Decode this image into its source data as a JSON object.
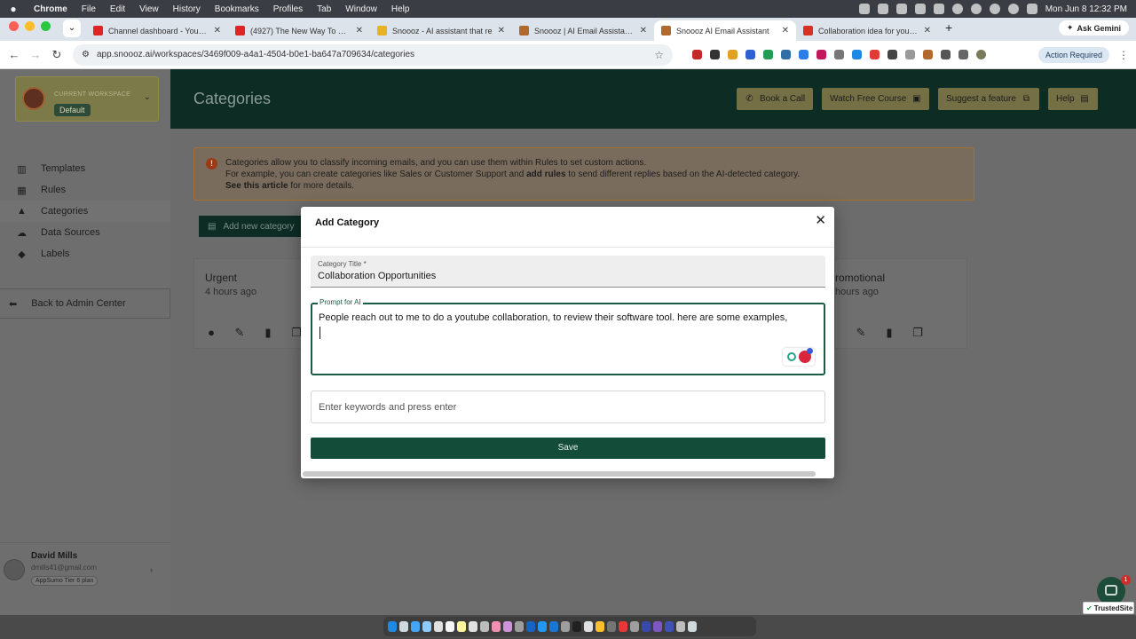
{
  "menubar": {
    "app": "Chrome",
    "items": [
      "File",
      "Edit",
      "View",
      "History",
      "Bookmarks",
      "Profiles",
      "Tab",
      "Window",
      "Help"
    ],
    "clock": "Mon Jun 8  12:32 PM"
  },
  "tabs": [
    {
      "label": "Channel dashboard - YouTube",
      "color": "#e02424"
    },
    {
      "label": "(4927) The New Way To Grow",
      "color": "#e02424"
    },
    {
      "label": "Snoooz - AI assistant that re",
      "color": "#e8b321"
    },
    {
      "label": "Snoooz | AI Email Assistant fo",
      "color": "#b06a2e"
    },
    {
      "label": "Snoooz AI Email Assistant",
      "color": "#b06a2e"
    },
    {
      "label": "Collaboration idea for your Yo",
      "color": "#d93025"
    }
  ],
  "ask_gemini": "Ask Gemini",
  "address": "app.snoooz.ai/workspaces/3469f009-a4a1-4504-b0e1-ba647a709634/categories",
  "action_required": "Action Required",
  "workspace": {
    "label": "CURRENT WORKSPACE",
    "name": "Default"
  },
  "nav": [
    {
      "label": "Templates",
      "icon": "templates-icon"
    },
    {
      "label": "Rules",
      "icon": "rules-icon"
    },
    {
      "label": "Categories",
      "icon": "categories-icon"
    },
    {
      "label": "Data Sources",
      "icon": "cloud-upload-icon"
    },
    {
      "label": "Labels",
      "icon": "tag-icon"
    }
  ],
  "back_admin": "Back to Admin Center",
  "user": {
    "name": "David Mills",
    "email": "dmills41@gmail.com",
    "plan": "AppSumo Tier 6 plan"
  },
  "header": {
    "title": "Categories",
    "buttons": [
      "Book a Call",
      "Watch Free Course",
      "Suggest a feature",
      "Help"
    ]
  },
  "alert": {
    "line1": "Categories allow you to classify incoming emails, and you can use them within Rules to set custom actions.",
    "line2_pre": "For example, you can create categories like Sales or Customer Support and ",
    "line2_link": "add rules",
    "line2_post": " to send different replies based on the AI-detected category.",
    "line3_link": "See this article",
    "line3_post": " for more details."
  },
  "add_category_button": "Add new category",
  "cards": [
    {
      "title": "Urgent",
      "time": "4 hours ago"
    },
    {
      "title": "romotional",
      "time": "hours ago"
    }
  ],
  "modal": {
    "title": "Add Category",
    "title_label": "Category Title *",
    "title_value": "Collaboration Opportunities",
    "prompt_label": "Prompt for AI",
    "prompt_value": "People reach out to me to do a youtube collaboration, to review their software tool. here are some examples,",
    "keywords_placeholder": "Enter keywords and press enter",
    "save": "Save"
  },
  "chat_badge": "1",
  "trusted_site": "TrustedSite"
}
